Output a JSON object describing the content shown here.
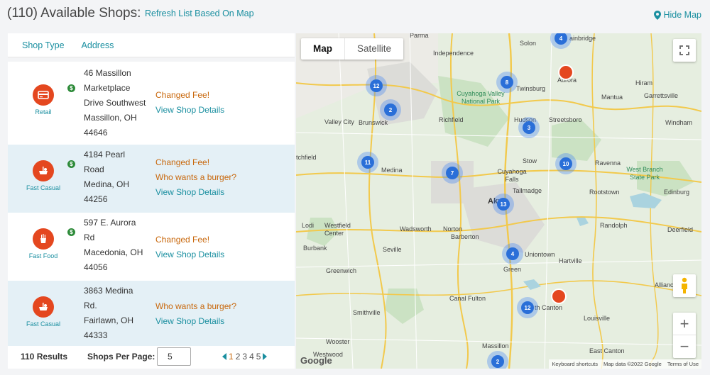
{
  "header": {
    "title": "(110) Available Shops:",
    "refresh_label": "Refresh List Based On Map",
    "hide_map_label": "Hide Map"
  },
  "list": {
    "columns": [
      "Shop Type",
      "Address"
    ],
    "shops": [
      {
        "type": "Retail",
        "address": [
          "46 Massillon",
          "Marketplace",
          "Drive Southwest",
          "Massillon, OH",
          "44646"
        ],
        "notes": [
          "Changed Fee!"
        ],
        "details_label": "View Shop Details",
        "icon": "retail-icon"
      },
      {
        "type": "Fast Casual",
        "address": [
          "4184 Pearl",
          "Road",
          "Medina, OH",
          "44256"
        ],
        "notes": [
          "Changed Fee!",
          "Who wants a burger?"
        ],
        "details_label": "View Shop Details",
        "icon": "fast-casual-icon"
      },
      {
        "type": "Fast Food",
        "address": [
          "597 E. Aurora",
          "Rd",
          "Macedonia, OH",
          "44056"
        ],
        "notes": [
          "Changed Fee!"
        ],
        "details_label": "View Shop Details",
        "icon": "fast-food-icon"
      },
      {
        "type": "Fast Casual",
        "address": [
          "3863 Medina",
          "Rd.",
          "Fairlawn, OH",
          "44333"
        ],
        "notes": [
          "Who wants a burger?"
        ],
        "details_label": "View Shop Details",
        "icon": "fast-casual-icon"
      }
    ],
    "dollar_badge": "$"
  },
  "footer": {
    "results": "110 Results",
    "per_page_label": "Shops Per Page:",
    "per_page_value": "5",
    "pages": [
      "1",
      "2",
      "3",
      "4",
      "5"
    ],
    "current_page": "1"
  },
  "map": {
    "tabs": {
      "map": "Map",
      "satellite": "Satellite"
    },
    "places": {
      "parma": "Parma",
      "solon": "Solon",
      "independence": "Independence",
      "bainbridge": "ainbridge",
      "aurora": "Aurora",
      "twinsburg": "Twinsburg",
      "mantua": "Mantua",
      "hiram": "Hiram",
      "garrettsville": "Garrettsville",
      "cuyahoga_valley": "Cuyahoga Valley National Park",
      "brunswick": "Brunswick",
      "richfield": "Richfield",
      "hudson": "Hudson",
      "streetsboro": "Streetsboro",
      "windham": "Windham",
      "valley_city": "Valley City",
      "tchfield": "tchfield",
      "medina": "Medina",
      "cuyahoga_falls": "Cuyahoga Falls",
      "stow": "Stow",
      "ravenna": "Ravenna",
      "west_branch": "West Branch State Park",
      "tallmadge": "Tallmadge",
      "rootstown": "Rootstown",
      "edinburg": "Edinburg",
      "akron": "Akr",
      "lodi": "Lodi",
      "westfield_center": "Westfield Center",
      "wadsworth": "Wadsworth",
      "norton": "Norton",
      "barberton": "Barberton",
      "randolph": "Randolph",
      "deerfield": "Deerfield",
      "burbank": "Burbank",
      "seville": "Seville",
      "uniontown": "Uniontown",
      "hartville": "Hartville",
      "green": "Green",
      "greenwich": "Greenwich",
      "alliance": "Alliance",
      "canal_fulton": "Canal Fulton",
      "north_canton": "th Canton",
      "smithville": "Smithville",
      "louisville": "Louisville",
      "wooster": "Wooster",
      "westwood": "Westwood",
      "massillon": "Massillon",
      "east_canton": "East Canton"
    },
    "clusters": [
      {
        "id": "c-4-top",
        "count": "4"
      },
      {
        "id": "c-12-nw",
        "count": "12"
      },
      {
        "id": "c-8",
        "count": "8"
      },
      {
        "id": "c-2",
        "count": "2"
      },
      {
        "id": "c-3",
        "count": "3"
      },
      {
        "id": "c-11",
        "count": "11"
      },
      {
        "id": "c-7",
        "count": "7"
      },
      {
        "id": "c-10",
        "count": "10"
      },
      {
        "id": "c-13",
        "count": "13"
      },
      {
        "id": "c-4-mid",
        "count": "4"
      },
      {
        "id": "c-12-se",
        "count": "12"
      },
      {
        "id": "c-2-bottom",
        "count": "2"
      }
    ],
    "zoom_in": "+",
    "zoom_out": "−",
    "google": "Google",
    "attribution": [
      "Keyboard shortcuts",
      "Map data ©2022 Google",
      "Terms of Use"
    ]
  },
  "colors": {
    "accent": "#1a8fa0",
    "warning": "#c8670b",
    "marker": "#e4471f",
    "cluster": "#2a6fd8"
  }
}
